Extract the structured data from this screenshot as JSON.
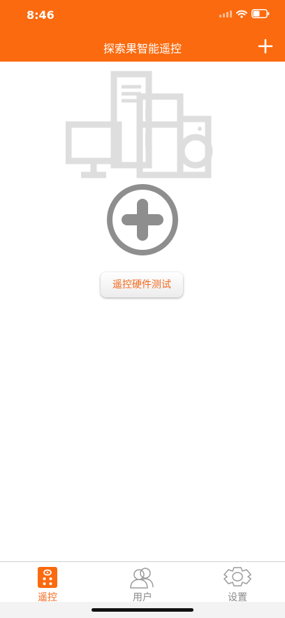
{
  "status_bar": {
    "time": "8:46"
  },
  "header": {
    "title": "探索果智能遥控"
  },
  "main": {
    "test_button_label": "遥控硬件测试"
  },
  "tabs": [
    {
      "label": "遥控",
      "icon": "remote-icon",
      "active": true
    },
    {
      "label": "用户",
      "icon": "users-icon",
      "active": false
    },
    {
      "label": "设置",
      "icon": "gear-icon",
      "active": false
    }
  ],
  "colors": {
    "accent": "#fb6a0e",
    "accent_text": "#f26a1e",
    "inactive": "#8a8a8a",
    "illustration": "#dedede",
    "add_icon": "#8e8e8e"
  }
}
